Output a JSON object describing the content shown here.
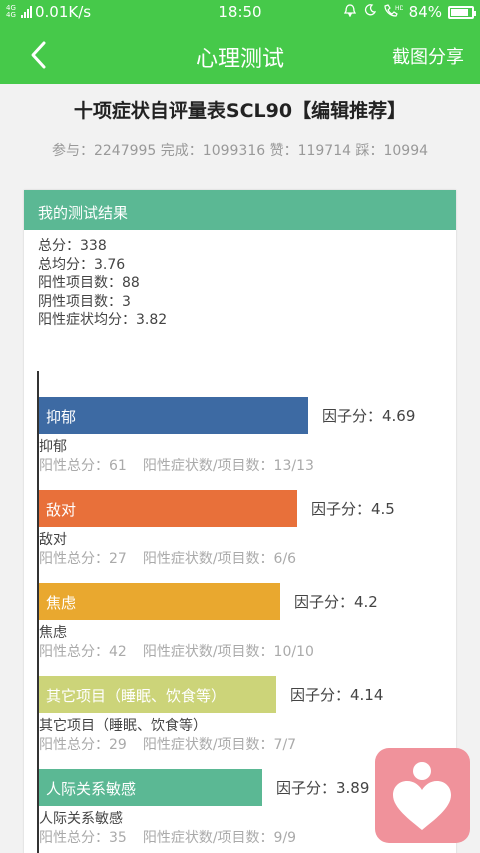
{
  "status_bar": {
    "network_type": "4G 4G",
    "speed": "0.01K/s",
    "time": "18:50",
    "battery": "84%",
    "battery_level": 0.84
  },
  "nav": {
    "title": "心理测试",
    "share_label": "截图分享"
  },
  "quiz": {
    "title": "十项症状自评量表SCL90【编辑推荐】",
    "stats": "参与：2247995 完成：1099316 赞：119714 踩：10994"
  },
  "result": {
    "header": "我的测试结果",
    "summary": [
      "总分：338",
      "总均分：3.76",
      "阳性项目数：88",
      "阴性项目数：3",
      "阳性症状均分：3.82"
    ]
  },
  "factors": [
    {
      "name": "抑郁",
      "score_label": "因子分：4.69",
      "score": 4.69,
      "total_label": "阳性总分：61",
      "count_label": "阳性症状数/项目数：13/13",
      "color": "#3d6aa3"
    },
    {
      "name": "敌对",
      "score_label": "因子分：4.5",
      "score": 4.5,
      "total_label": "阳性总分：27",
      "count_label": "阳性症状数/项目数：6/6",
      "color": "#e8703a"
    },
    {
      "name": "焦虑",
      "score_label": "因子分：4.2",
      "score": 4.2,
      "total_label": "阳性总分：42",
      "count_label": "阳性症状数/项目数：10/10",
      "color": "#e9a82f"
    },
    {
      "name": "其它项目（睡眠、饮食等）",
      "score_label": "因子分：4.14",
      "score": 4.14,
      "total_label": "阳性总分：29",
      "count_label": "阳性症状数/项目数：7/7",
      "color": "#ccd479"
    },
    {
      "name": "人际关系敏感",
      "score_label": "因子分：3.89",
      "score": 3.89,
      "total_label": "阳性总分：35",
      "count_label": "阳性症状数/项目数：9/9",
      "color": "#5bb894"
    }
  ],
  "colors": {
    "primary": "#46c94a",
    "card_header": "#5bb894",
    "floating_button": "#f0929b"
  }
}
